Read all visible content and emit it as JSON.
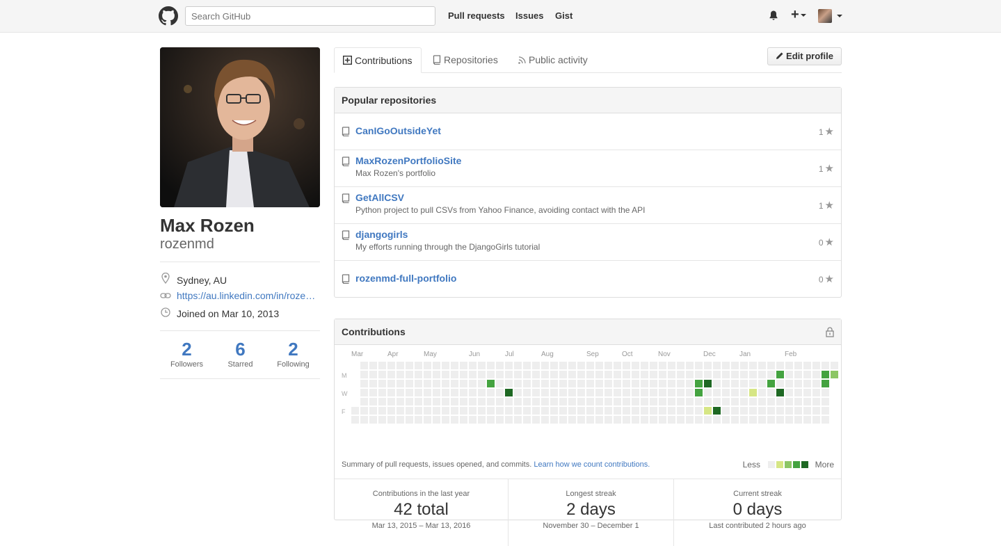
{
  "header": {
    "search_placeholder": "Search GitHub",
    "nav": [
      "Pull requests",
      "Issues",
      "Gist"
    ],
    "plus_label": "+"
  },
  "profile": {
    "name": "Max Rozen",
    "username": "rozenmd",
    "location": "Sydney, AU",
    "website": "https://au.linkedin.com/in/roze…",
    "joined": "Joined on Mar 10, 2013",
    "stats": [
      {
        "num": "2",
        "label": "Followers"
      },
      {
        "num": "6",
        "label": "Starred"
      },
      {
        "num": "2",
        "label": "Following"
      }
    ]
  },
  "tabs": {
    "contributions": "Contributions",
    "repositories": "Repositories",
    "public_activity": "Public activity",
    "edit_profile": "Edit profile"
  },
  "popular": {
    "title": "Popular repositories",
    "repos": [
      {
        "name": "CanIGoOutsideYet",
        "desc": "",
        "stars": "1"
      },
      {
        "name": "MaxRozenPortfolioSite",
        "desc": "Max Rozen's portfolio",
        "stars": "1"
      },
      {
        "name": "GetAllCSV",
        "desc": "Python project to pull CSVs from Yahoo Finance, avoiding contact with the API",
        "stars": "1"
      },
      {
        "name": "djangogirls",
        "desc": "My efforts running through the DjangoGirls tutorial",
        "stars": "0"
      },
      {
        "name": "rozenmd-full-portfolio",
        "desc": "",
        "stars": "0"
      }
    ]
  },
  "contributions": {
    "title": "Contributions",
    "months": [
      "Mar",
      "Apr",
      "May",
      "Jun",
      "Jul",
      "Aug",
      "Sep",
      "Oct",
      "Nov",
      "Dec",
      "Jan",
      "Feb"
    ],
    "days": [
      "M",
      "W",
      "F"
    ],
    "summary": "Summary of pull requests, issues opened, and commits.",
    "learn_link": "Learn how we count contributions.",
    "legend_less": "Less",
    "legend_more": "More",
    "colors": [
      "#eeeeee",
      "#d6e685",
      "#8cc665",
      "#44a340",
      "#1e6823"
    ],
    "active_cells": [
      {
        "week": 15,
        "day": 2,
        "level": 3
      },
      {
        "week": 17,
        "day": 3,
        "level": 4
      },
      {
        "week": 38,
        "day": 2,
        "level": 3
      },
      {
        "week": 38,
        "day": 3,
        "level": 3
      },
      {
        "week": 39,
        "day": 2,
        "level": 4
      },
      {
        "week": 39,
        "day": 5,
        "level": 1
      },
      {
        "week": 40,
        "day": 5,
        "level": 4
      },
      {
        "week": 44,
        "day": 3,
        "level": 1
      },
      {
        "week": 46,
        "day": 2,
        "level": 3
      },
      {
        "week": 47,
        "day": 1,
        "level": 3
      },
      {
        "week": 47,
        "day": 3,
        "level": 4
      },
      {
        "week": 52,
        "day": 1,
        "level": 3
      },
      {
        "week": 52,
        "day": 2,
        "level": 3
      },
      {
        "week": 53,
        "day": 1,
        "level": 2
      }
    ],
    "stats": [
      {
        "title": "Contributions in the last year",
        "value": "42 total",
        "detail": "Mar 13, 2015 – Mar 13, 2016"
      },
      {
        "title": "Longest streak",
        "value": "2 days",
        "detail": "November 30 – December 1"
      },
      {
        "title": "Current streak",
        "value": "0 days",
        "detail": "Last contributed 2 hours ago"
      }
    ]
  }
}
